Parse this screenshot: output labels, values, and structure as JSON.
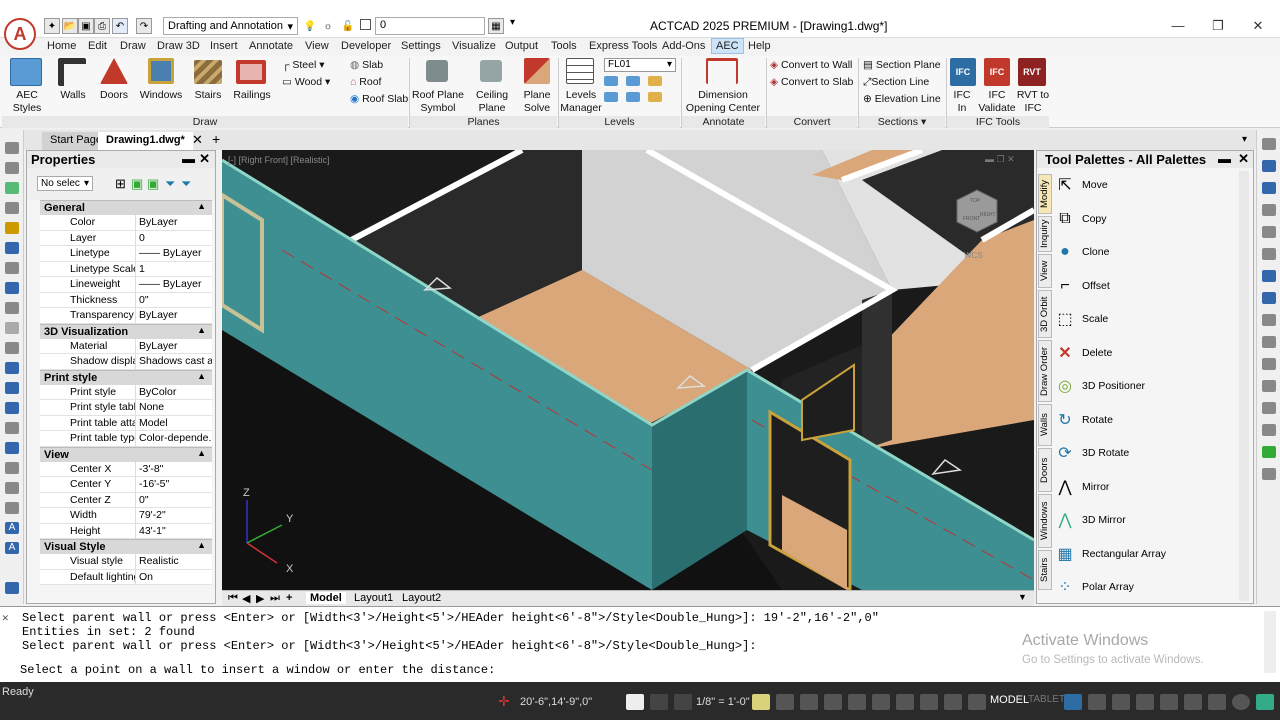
{
  "titlebar": {
    "workspace": "Drafting and Annotation",
    "layer": "0",
    "title": "ACTCAD 2025 PREMIUM - [Drawing1.dwg*]"
  },
  "menu": [
    "Home",
    "Edit",
    "Draw",
    "Draw 3D",
    "Insert",
    "Annotate",
    "View",
    "Developer",
    "Settings",
    "Visualize",
    "Output",
    "Tools",
    "Express Tools",
    "Add-Ons",
    "AEC",
    "Help"
  ],
  "ribbon": {
    "aec_styles": "AEC Styles Manager",
    "walls": "Walls",
    "doors": "Doors",
    "windows": "Windows",
    "stairs": "Stairs",
    "railings": "Railings",
    "steel": "Steel",
    "wood": "Wood",
    "slab": "Slab",
    "roof": "Roof",
    "roof_slab": "Roof Slab",
    "draw_label": "Draw",
    "roof_plane_symbol": "Roof Plane Symbol",
    "ceiling_plane_symbol": "Ceiling Plane Symbol",
    "plane_solve": "Plane Solve",
    "planes_label": "Planes",
    "levels_manager": "Levels Manager",
    "level_value": "FL01",
    "levels_label": "Levels",
    "dimension_opening": "Dimension Opening Center",
    "annotate_label": "Annotate",
    "convert_wall": "Convert to Wall",
    "convert_slab": "Convert to Slab",
    "convert_label": "Convert",
    "section_plane": "Section Plane",
    "section_line": "Section Line",
    "elevation_line": "Elevation Line",
    "sections_label": "Sections",
    "ifc_in": "IFC In",
    "ifc_validate": "IFC Validate",
    "rvt_to_ifc": "RVT to IFC",
    "ifc_tools_label": "IFC Tools"
  },
  "doctabs": [
    "Start Page",
    "Drawing1.dwg*"
  ],
  "properties": {
    "title": "Properties",
    "selection": "No selec",
    "sections": [
      {
        "name": "General",
        "rows": [
          [
            "Color",
            "ByLayer"
          ],
          [
            "Layer",
            "0"
          ],
          [
            "Linetype",
            "—— ByLayer"
          ],
          [
            "Linetype Scale",
            "1"
          ],
          [
            "Lineweight",
            "—— ByLayer"
          ],
          [
            "Thickness",
            "0\""
          ],
          [
            "Transparency",
            "ByLayer"
          ]
        ]
      },
      {
        "name": "3D Visualization",
        "rows": [
          [
            "Material",
            "ByLayer"
          ],
          [
            "Shadow display",
            "Shadows cast a..."
          ]
        ]
      },
      {
        "name": "Print style",
        "rows": [
          [
            "Print style",
            "ByColor"
          ],
          [
            "Print style table",
            "None"
          ],
          [
            "Print table attac...",
            "Model"
          ],
          [
            "Print table type",
            "Color-depende..."
          ]
        ]
      },
      {
        "name": "View",
        "rows": [
          [
            "Center X",
            "-3'-8\""
          ],
          [
            "Center Y",
            "-16'-5\""
          ],
          [
            "Center Z",
            "0\""
          ],
          [
            "Width",
            "79'-2\""
          ],
          [
            "Height",
            "43'-1\""
          ]
        ]
      },
      {
        "name": "Visual Style",
        "rows": [
          [
            "Visual style",
            "Realistic"
          ],
          [
            "Default lighting",
            "On"
          ]
        ]
      }
    ]
  },
  "viewport": {
    "label": "[-] [Right Front] [Realistic]",
    "cube_top": "TOP",
    "cube_front": "FRONT",
    "cube_right": "RIGHT",
    "wcs": "WCS",
    "axis_x": "X",
    "axis_y": "Y",
    "axis_z": "Z",
    "tabs": [
      "Model",
      "Layout1",
      "Layout2"
    ]
  },
  "tool_palettes": {
    "title": "Tool Palettes - All Palettes",
    "vtabs": [
      "Modify",
      "Inquiry",
      "View",
      "3D Orbit",
      "Draw Order",
      "Walls",
      "Doors",
      "Windows",
      "Stairs"
    ],
    "tools": [
      "Move",
      "Copy",
      "Clone",
      "Offset",
      "Scale",
      "Delete",
      "3D Positioner",
      "Rotate",
      "3D Rotate",
      "Mirror",
      "3D Mirror",
      "Rectangular Array",
      "Polar Array"
    ]
  },
  "command": {
    "lines": [
      "Select parent wall or press <Enter> or [Width<3'>/Height<5'>/HEAder height<6'-8\">/Style<Double_Hung>]: 19'-2\",16'-2\",0\"",
      "Entities in set: 2 found",
      "Select parent wall or press <Enter> or [Width<3'>/Height<5'>/HEAder height<6'-8\">/Style<Double_Hung>]:"
    ],
    "prompt": "Select a point on a wall to insert a window or enter the distance:"
  },
  "watermark": {
    "title": "Activate Windows",
    "subtitle": "Go to Settings to activate Windows."
  },
  "status": {
    "ready": "Ready",
    "coords": "20'-6\",14'-9\",0\"",
    "scale": "1/8\" = 1'-0\"",
    "model": "MODEL",
    "tablet": "TABLET"
  },
  "colors": {
    "wall_teal": "#3d8f91",
    "floor_tan": "#d9a77a",
    "aec_tab": "#cde3f7"
  }
}
